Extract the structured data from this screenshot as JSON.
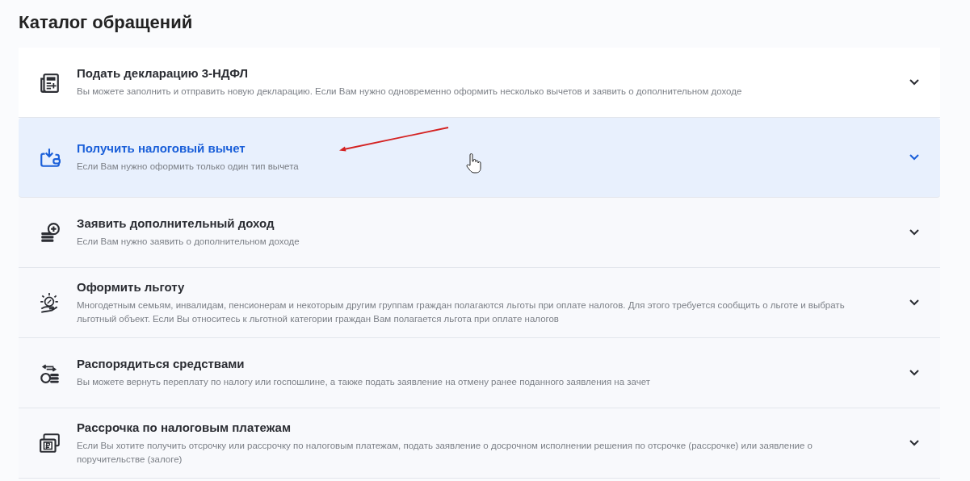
{
  "page_title": "Каталог обращений",
  "items": [
    {
      "title": "Подать декларацию 3-НДФЛ",
      "description": "Вы можете заполнить и отправить новую декларацию. Если Вам нужно одновременно оформить несколько вычетов и заявить о дополнительном доходе",
      "highlighted": false
    },
    {
      "title": "Получить налоговый вычет",
      "description": "Если Вам нужно оформить только один тип вычета",
      "highlighted": true
    },
    {
      "title": "Заявить дополнительный доход",
      "description": "Если Вам нужно заявить о дополнительном доходе",
      "highlighted": false
    },
    {
      "title": "Оформить льготу",
      "description": "Многодетным семьям, инвалидам, пенсионерам и некоторым другим группам граждан полагаются льготы при оплате налогов. Для этого требуется сообщить о льготе и выбрать льготный объект. Если Вы относитесь к льготной категории граждан Вам полагается льгота при оплате налогов",
      "highlighted": false
    },
    {
      "title": "Распорядиться средствами",
      "description": "Вы можете вернуть переплату по налогу или госпошлине, а также подать заявление на отмену ранее поданного заявления на зачет",
      "highlighted": false
    },
    {
      "title": "Рассрочка по налоговым платежам",
      "description": "Если Вы хотите получить отсрочку или рассрочку по налоговым платежам, подать заявление о досрочном исполнении решения по отсрочке (рассрочке) или заявление о поручительстве (залоге)",
      "highlighted": false
    }
  ]
}
